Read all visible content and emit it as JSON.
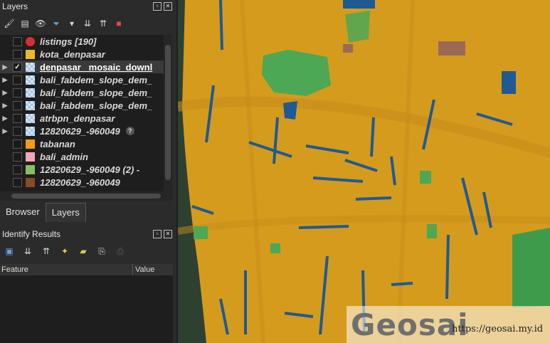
{
  "layers_panel": {
    "title": "Layers",
    "tree": [
      {
        "label": "listings [190]",
        "type": "point",
        "color": "#d62f2f",
        "expand": false,
        "checked": false
      },
      {
        "label": "kota_denpasar",
        "type": "fill",
        "color": "#e8b92c",
        "expand": false,
        "checked": false
      },
      {
        "label": "denpasar _mosaic_downl",
        "type": "raster",
        "expand": true,
        "checked": true,
        "selected": true,
        "underline": true
      },
      {
        "label": "bali_fabdem_slope_dem_",
        "type": "raster",
        "expand": true,
        "checked": false
      },
      {
        "label": "bali_fabdem_slope_dem_",
        "type": "raster",
        "expand": true,
        "checked": false
      },
      {
        "label": "bali_fabdem_slope_dem_",
        "type": "raster",
        "expand": true,
        "checked": false
      },
      {
        "label": "atrbpn_denpasar",
        "type": "raster",
        "expand": true,
        "checked": false
      },
      {
        "label": "12820629_-960049",
        "type": "raster",
        "expand": true,
        "checked": false,
        "warning": true
      },
      {
        "label": "tabanan",
        "type": "fill",
        "color": "#f29d12",
        "expand": false,
        "checked": false
      },
      {
        "label": "bali_admin",
        "type": "fill",
        "color": "#f5a6b4",
        "expand": false,
        "checked": false
      },
      {
        "label": "12820629_-960049 (2) -",
        "type": "fill",
        "color": "#88c060",
        "expand": false,
        "checked": false
      },
      {
        "label": "12820629_-960049",
        "type": "fill",
        "color": "#8a4a24",
        "expand": false,
        "checked": false
      }
    ]
  },
  "tabs": [
    "Browser",
    "Layers"
  ],
  "active_tab": "Layers",
  "identify_panel": {
    "title": "Identify Results",
    "columns": [
      "Feature",
      "Value"
    ]
  },
  "watermark": {
    "brand": "Geosai",
    "url": "https://geosai.my.id"
  },
  "colors": {
    "panel_bg": "#2b2b2b",
    "tree_bg": "#1e1e1e",
    "map_orange": "#e3a21a",
    "map_green": "#4ca855",
    "map_blue": "#1f5a93"
  }
}
